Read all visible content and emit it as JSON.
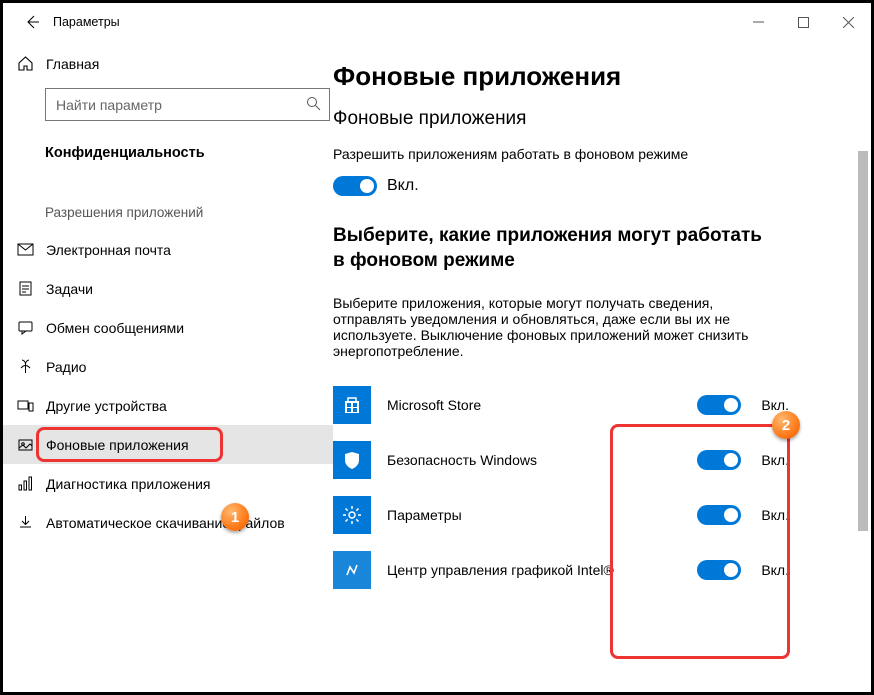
{
  "window": {
    "title": "Параметры"
  },
  "sidebar": {
    "home": "Главная",
    "search_placeholder": "Найти параметр",
    "category": "Конфиденциальность",
    "group": "Разрешения приложений",
    "items": [
      {
        "label": "Электронная почта"
      },
      {
        "label": "Задачи"
      },
      {
        "label": "Обмен сообщениями"
      },
      {
        "label": "Радио"
      },
      {
        "label": "Другие устройства"
      },
      {
        "label": "Фоновые приложения"
      },
      {
        "label": "Диагностика приложения"
      },
      {
        "label": "Автоматическое скачивание файлов"
      }
    ],
    "badge1": "1"
  },
  "main": {
    "heading": "Фоновые приложения",
    "subheading": "Фоновые приложения",
    "allow_text": "Разрешить приложениям работать в фоновом режиме",
    "master_state": "Вкл.",
    "choose_heading": "Выберите, какие приложения могут работать в фоновом режиме",
    "desc": "Выберите приложения, которые могут получать сведения, отправлять уведомления и обновляться, даже если вы их не используете. Выключение фоновых приложений может снизить энергопотребление.",
    "apps": [
      {
        "name": "Microsoft Store",
        "state": "Вкл."
      },
      {
        "name": "Безопасность Windows",
        "state": "Вкл."
      },
      {
        "name": "Параметры",
        "state": "Вкл."
      },
      {
        "name": "Центр управления графикой Intel®",
        "state": "Вкл."
      }
    ],
    "badge2": "2"
  }
}
